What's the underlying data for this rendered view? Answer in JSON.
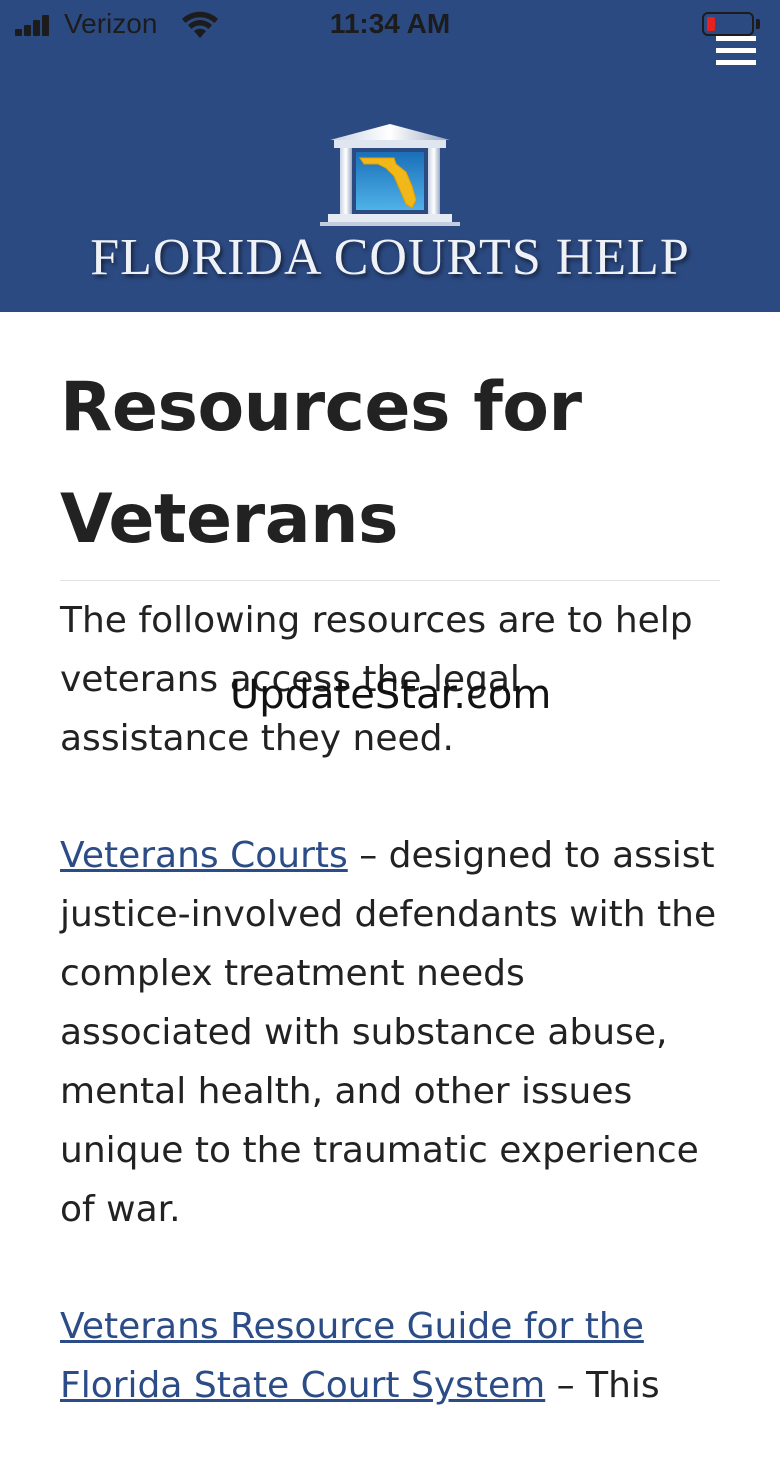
{
  "status_bar": {
    "carrier": "Verizon",
    "time": "11:34 AM",
    "battery_level": 0.1
  },
  "header": {
    "logo_text": "FLORIDA COURTS HELP",
    "menu_icon": "hamburger-menu-icon",
    "background_color": "#2c4a82"
  },
  "main": {
    "title": "Resources for Veterans",
    "intro": "The following resources are to help veterans access the legal assistance they need.",
    "items": [
      {
        "link_text": "Veterans Courts",
        "description": " – designed to assist justice-involved defendants with the complex treatment needs associated with substance abuse, mental health, and other issues unique to the traumatic experience of war."
      },
      {
        "link_text": "Veterans Resource Guide for the Florida State Court System",
        "description": " – This"
      }
    ],
    "link_color": "#2b4c87"
  },
  "watermark": "UpdateStar.com"
}
